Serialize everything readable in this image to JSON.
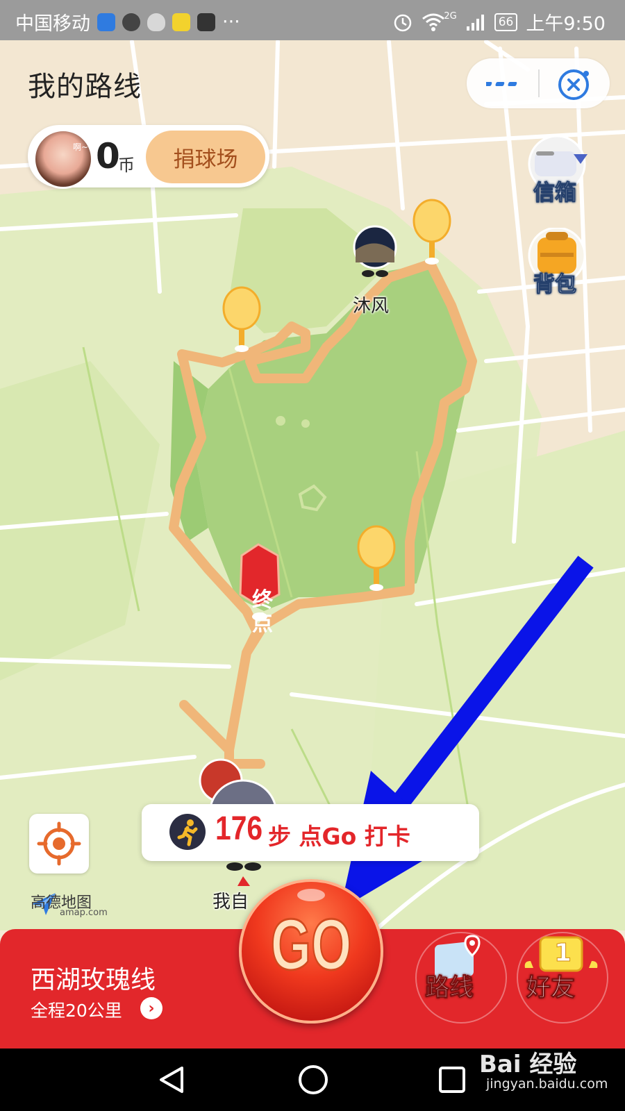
{
  "status_bar": {
    "carrier": "中国移动",
    "more": "···",
    "network": "2G",
    "battery": "66",
    "time": "上午9:50"
  },
  "header": {
    "title": "我的路线"
  },
  "user": {
    "avatar_tag": "啊~",
    "coins": "0",
    "coin_unit": "币",
    "donate_label": "捐球场"
  },
  "side_buttons": {
    "mailbox_label": "信箱",
    "backpack_label": "背包"
  },
  "map": {
    "friend_name": "沐风",
    "end_marker": "终点",
    "me_label": "我自"
  },
  "steps": {
    "count": "176",
    "text": "步 点Go 打卡"
  },
  "map_brand": {
    "name": "高德地图",
    "domain": "amap.com"
  },
  "route": {
    "name": "西湖玫瑰线",
    "distance": "全程20公里",
    "arrow": "›"
  },
  "go_button": {
    "label": "GO"
  },
  "bottom_buttons": {
    "route_label": "路线",
    "friends_label": "好友",
    "friends_badge": "1"
  },
  "watermark": {
    "main": "Bai 经验",
    "sub": "jingyan.baidu.com"
  },
  "colors": {
    "accent_red": "#e2272b",
    "route_orange": "#f0b679",
    "park_green": "#a8d07e",
    "annotation_arrow": "#0a14e8"
  }
}
